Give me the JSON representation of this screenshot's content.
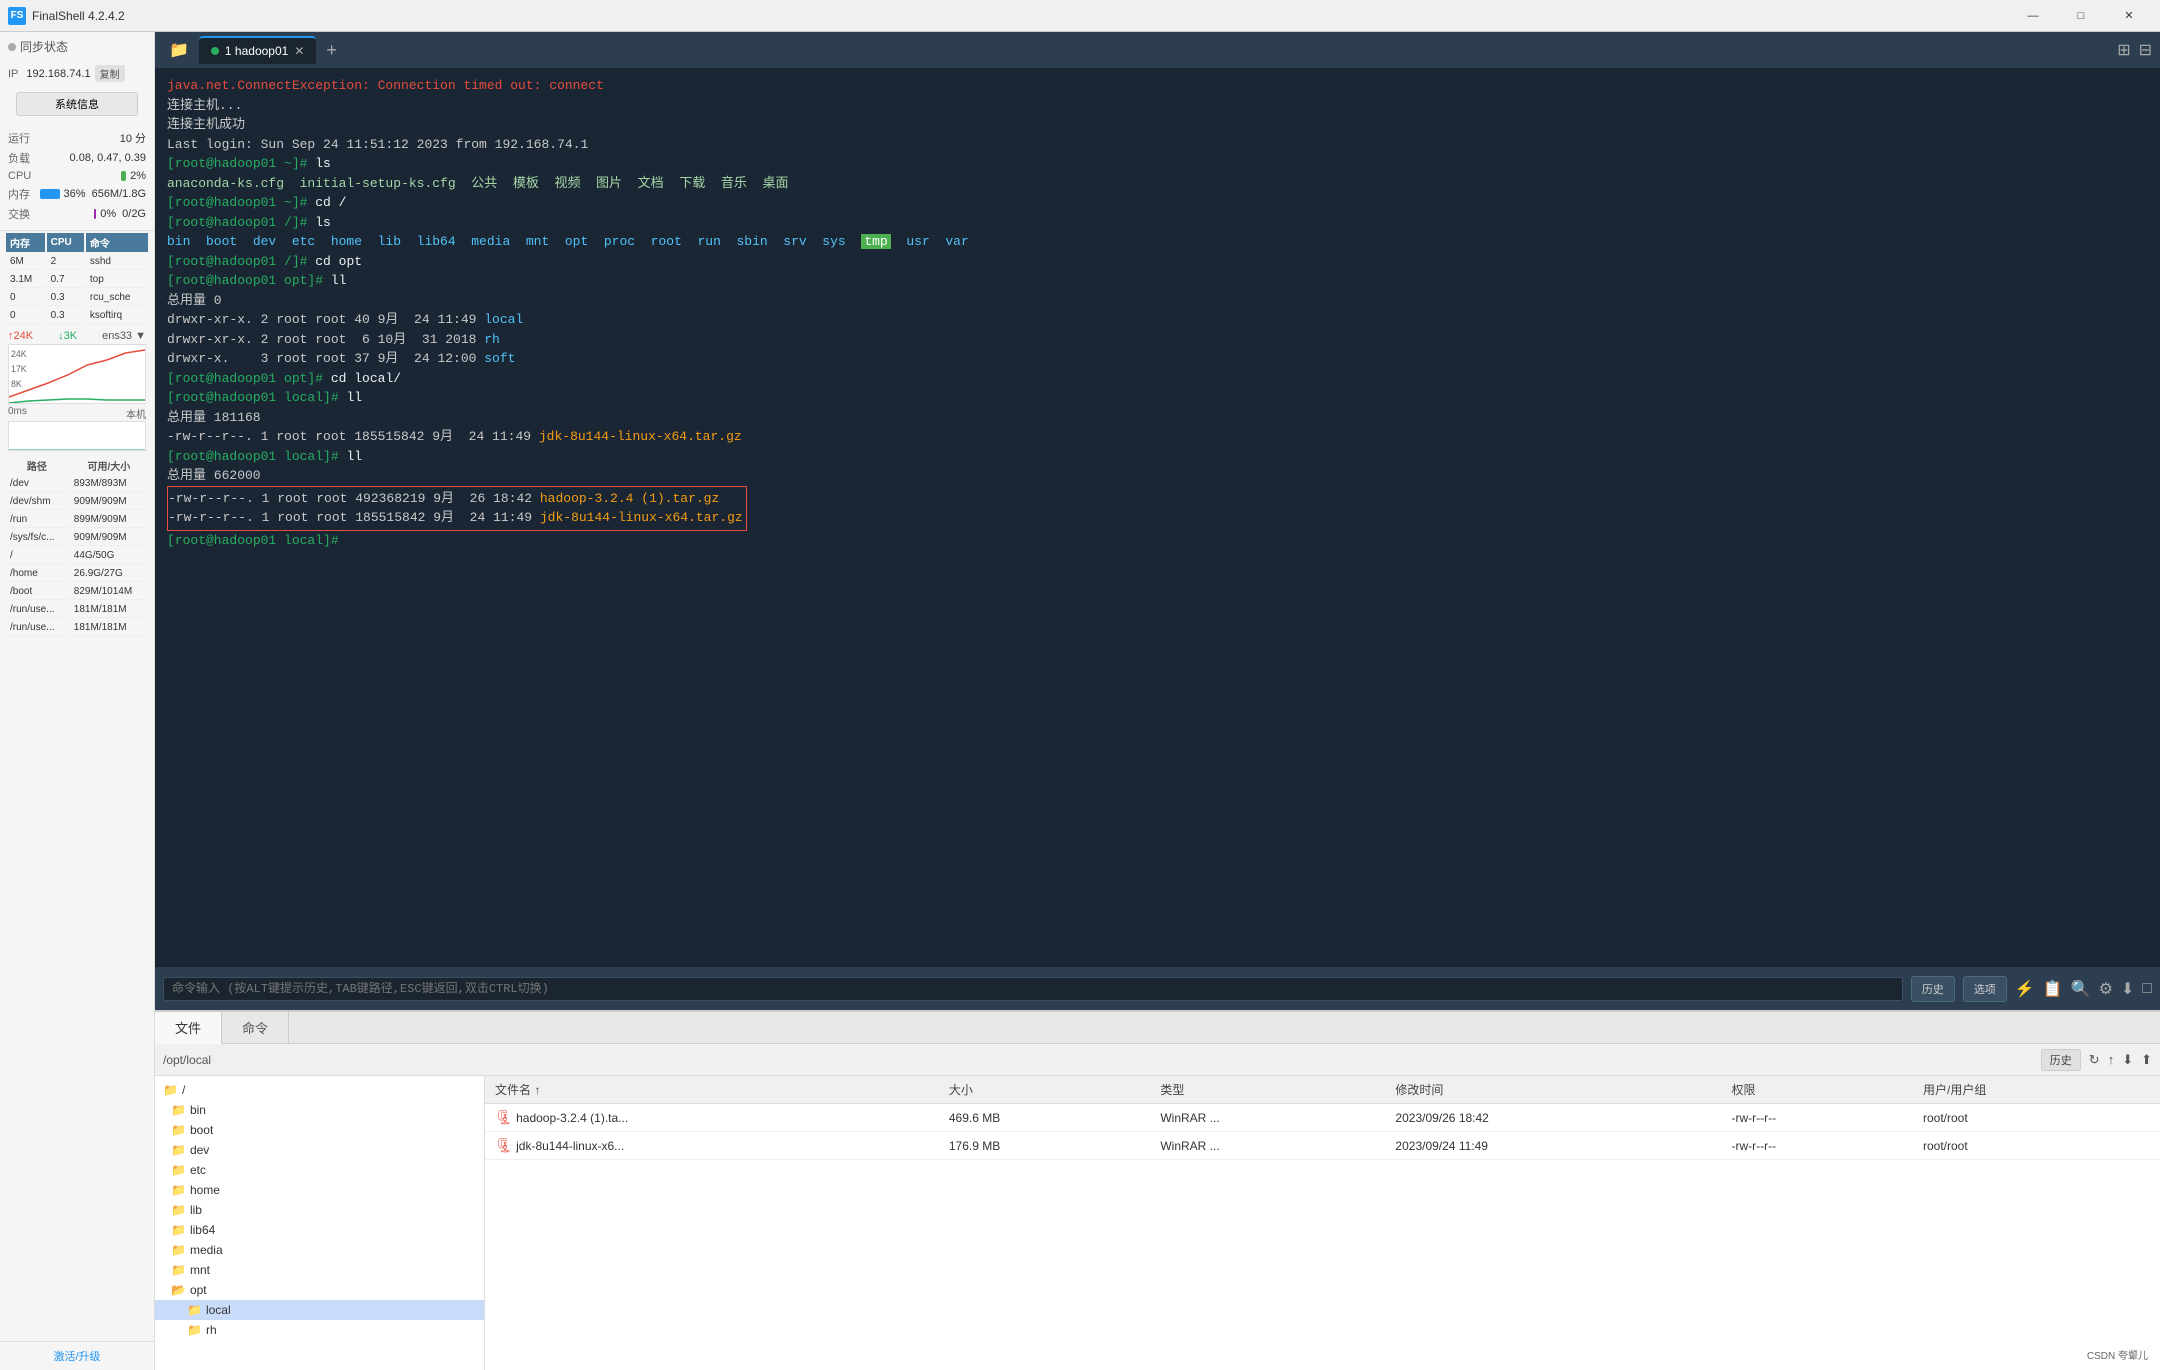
{
  "app": {
    "title": "FinalShell 4.2.4.2",
    "icon": "FS"
  },
  "window_controls": {
    "minimize": "—",
    "maximize": "□",
    "close": "✕"
  },
  "sidebar": {
    "sync_status": "同步状态",
    "ip_label": "IP",
    "ip_value": "192.168.74.1",
    "copy_label": "复制",
    "sys_info_btn": "系统信息",
    "uptime_label": "运行",
    "uptime_value": "10 分",
    "load_label": "负载",
    "load_value": "0.08, 0.47, 0.39",
    "cpu_label": "CPU",
    "cpu_value": "2%",
    "mem_label": "内存",
    "mem_value": "36%",
    "mem_detail": "656M/1.8G",
    "swap_label": "交换",
    "swap_value": "0%",
    "swap_detail": "0/2G",
    "process_headers": [
      "内存",
      "CPU",
      "命令"
    ],
    "processes": [
      {
        "mem": "6M",
        "cpu": "2",
        "cmd": "sshd"
      },
      {
        "mem": "3.1M",
        "cpu": "0.7",
        "cmd": "top"
      },
      {
        "mem": "0",
        "cpu": "0.3",
        "cmd": "rcu_sche"
      },
      {
        "mem": "0",
        "cpu": "0.3",
        "cmd": "ksoftirq"
      }
    ],
    "net_up": "↑24K",
    "net_down": "↓3K",
    "net_interface": "ens33",
    "net_values": [
      24,
      17,
      8
    ],
    "net_labels": [
      "24K",
      "17K",
      "8K"
    ],
    "latency_label": "0ms",
    "machine_label": "本机",
    "latency_values": [
      0,
      0,
      0
    ],
    "disks": [
      {
        "path": "/dev",
        "avail": "893M",
        "size": "893M"
      },
      {
        "path": "/dev/shm",
        "avail": "909M",
        "size": "909M"
      },
      {
        "path": "/run",
        "avail": "899M",
        "size": "909M"
      },
      {
        "path": "/sys/fs/c...",
        "avail": "909M",
        "size": "909M"
      },
      {
        "path": "/",
        "avail": "44G",
        "size": "50G"
      },
      {
        "path": "/home",
        "avail": "26.9G",
        "size": "27G"
      },
      {
        "path": "/boot",
        "avail": "829M",
        "size": "1014M"
      },
      {
        "path": "/run/use...",
        "avail": "181M",
        "size": "181M"
      },
      {
        "path": "/run/use...",
        "avail": "181M",
        "size": "181M"
      }
    ],
    "activate_label": "激活/升级"
  },
  "tabs": {
    "folder_icon": "📁",
    "items": [
      {
        "label": "1 hadoop01",
        "active": true,
        "dot_color": "#27ae60"
      },
      {
        "label": "+",
        "is_add": true
      }
    ],
    "right_icons": [
      "⊞",
      "⊟"
    ]
  },
  "terminal": {
    "lines": [
      {
        "text": "java.net.ConnectException: Connection timed out: connect",
        "color": "default"
      },
      {
        "text": "连接主机...",
        "color": "default"
      },
      {
        "text": "连接主机成功",
        "color": "default"
      },
      {
        "text": "Last login: Sun Sep 24 11:51:12 2023 from 192.168.74.1",
        "color": "default"
      },
      {
        "text": "[root@hadoop01 ~]# ls",
        "color": "prompt"
      },
      {
        "text": "anaconda-ks.cfg  initial-setup-ks.cfg  公共  模板  视频  图片  文档  下载  音乐  桌面",
        "color": "ls"
      },
      {
        "text": "[root@hadoop01 ~]# cd /",
        "color": "prompt"
      },
      {
        "text": "[root@hadoop01 /]# ls",
        "color": "prompt"
      },
      {
        "text": "bin  boot  dev  etc  home  lib  lib64  media  mnt  opt  proc  root  run  sbin  srv  sys  tmp  usr  var",
        "color": "ls-dirs"
      },
      {
        "text": "[root@hadoop01 /]# cd opt",
        "color": "prompt"
      },
      {
        "text": "[root@hadoop01 opt]# ll",
        "color": "prompt"
      },
      {
        "text": "总用量 0",
        "color": "default"
      },
      {
        "text": "drwxr-xr-x. 2 root root 40 9月  24 11:49 local",
        "color": "dir-entry"
      },
      {
        "text": "drwxr-xr-x. 2 root root  6 10月  31 2018 rh",
        "color": "dir-entry"
      },
      {
        "text": "drwxr-x.    3 root root 37 9月  24 12:00 soft",
        "color": "dir-entry"
      },
      {
        "text": "[root@hadoop01 opt]# cd local/",
        "color": "prompt"
      },
      {
        "text": "[root@hadoop01 local]# ll",
        "color": "prompt"
      },
      {
        "text": "总用量 181168",
        "color": "default"
      },
      {
        "text": "-rw-r--r--. 1 root root 185515842 9月  24 11:49 jdk-8u144-linux-x64.tar.gz",
        "color": "file-jdk"
      },
      {
        "text": "[root@hadoop01 local]# ll",
        "color": "prompt"
      },
      {
        "text": "总用量 662000",
        "color": "default"
      },
      {
        "text": "-rw-r--r--. 1 root root 492368219 9月  26 18:42 hadoop-3.2.4 (1).tar.gz",
        "color": "file-hadoop",
        "selected": true
      },
      {
        "text": "-rw-r--r--. 1 root root 185515842 9月  24 11:49 jdk-8u144-linux-x64.tar.gz",
        "color": "file-jdk",
        "selected": true
      },
      {
        "text": "[root@hadoop01 local]#",
        "color": "prompt"
      }
    ]
  },
  "cmd_bar": {
    "placeholder": "命令输入 (按ALT键提示历史,TAB键路径,ESC键返回,双击CTRL切换)",
    "history_btn": "历史",
    "options_btn": "选项",
    "icons": [
      "⚡",
      "📋",
      "🔍",
      "⚙",
      "⬇",
      "□"
    ]
  },
  "file_manager": {
    "tabs": [
      "文件",
      "命令"
    ],
    "active_tab": "文件",
    "path": "/opt/local",
    "history_btn": "历史",
    "toolbar_icons": [
      "↻",
      "↑",
      "⬇",
      "⬆"
    ],
    "tree": {
      "root": "/",
      "items": [
        {
          "name": "bin",
          "indent": 1,
          "type": "folder"
        },
        {
          "name": "boot",
          "indent": 1,
          "type": "folder"
        },
        {
          "name": "dev",
          "indent": 1,
          "type": "folder"
        },
        {
          "name": "etc",
          "indent": 1,
          "type": "folder"
        },
        {
          "name": "home",
          "indent": 1,
          "type": "folder"
        },
        {
          "name": "lib",
          "indent": 1,
          "type": "folder"
        },
        {
          "name": "lib64",
          "indent": 1,
          "type": "folder"
        },
        {
          "name": "media",
          "indent": 1,
          "type": "folder"
        },
        {
          "name": "mnt",
          "indent": 1,
          "type": "folder"
        },
        {
          "name": "opt",
          "indent": 1,
          "type": "folder-open"
        },
        {
          "name": "local",
          "indent": 2,
          "type": "folder",
          "selected": true
        },
        {
          "name": "rh",
          "indent": 2,
          "type": "folder"
        }
      ]
    },
    "files_headers": [
      "文件名 ↑",
      "大小",
      "类型",
      "修改时间",
      "权限",
      "用户/用户组"
    ],
    "files": [
      {
        "name": "hadoop-3.2.4 (1).ta...",
        "size": "469.6 MB",
        "type": "WinRAR ...",
        "modified": "2023/09/26 18:42",
        "permissions": "-rw-r--r--",
        "owner": "root/root",
        "icon": "winrar"
      },
      {
        "name": "jdk-8u144-linux-x6...",
        "size": "176.9 MB",
        "type": "WinRAR ...",
        "modified": "2023/09/24 11:49",
        "permissions": "-rw-r--r--",
        "owner": "root/root",
        "icon": "winrar"
      }
    ]
  },
  "watermark": "CSDN 夸颦儿"
}
